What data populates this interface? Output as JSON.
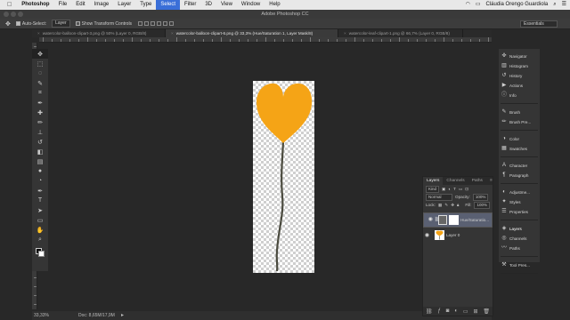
{
  "menubar": {
    "apple": "",
    "app_name": "Photoshop",
    "items": [
      "File",
      "Edit",
      "Image",
      "Layer",
      "Type",
      "Select",
      "Filter",
      "3D",
      "View",
      "Window",
      "Help"
    ],
    "active_item": "Select",
    "user": "Cláudia Orengo Guardiola"
  },
  "window": {
    "title": "Adobe Photoshop CC"
  },
  "options_bar": {
    "auto_select_label": "Auto-Select:",
    "auto_select_value": "Layer",
    "transform_label": "Show Transform Controls",
    "workspace": "Essentials"
  },
  "tabs": [
    {
      "label": "watercolor-balloon-clipart-3.png @ 50% (Layer 0, RGB/8)"
    },
    {
      "label": "watercolor-balloon-clipart-6.png @ 33,3% (Hue/Saturation 1, Layer Mask/8)"
    },
    {
      "label": "watercolor-leaf-clipart-1.png @ 66,7% (Layer 0, RGB/8)"
    }
  ],
  "status_bar": {
    "zoom": "33,33%",
    "doc": "Doc: 8,65M/17,9M"
  },
  "layers_panel": {
    "tabs": [
      "Layers",
      "Channels",
      "Paths"
    ],
    "kind_label": "Kind",
    "blend_mode": "Normal",
    "opacity_label": "Opacity:",
    "opacity_value": "100%",
    "lock_label": "Lock:",
    "fill_label": "Fill:",
    "fill_value": "100%",
    "layers": [
      {
        "name": "Hue/Saturatio...",
        "selected": true
      },
      {
        "name": "Layer 0",
        "selected": false
      }
    ]
  },
  "dock": {
    "groups": [
      [
        "Navigator",
        "Histogram",
        "History",
        "Actions",
        "Info"
      ],
      [
        "Brush",
        "Brush Pre..."
      ],
      [
        "Color",
        "Swatches"
      ],
      [
        "Character",
        "Paragraph"
      ],
      [
        "Adjustme...",
        "Styles",
        "Properties"
      ],
      [
        "Layers",
        "Channels",
        "Paths"
      ],
      [
        "Tool Pres..."
      ]
    ]
  },
  "colors": {
    "balloon": "#f5a416",
    "string": "#4a4a3e",
    "menu_active": "#3a6fd8"
  }
}
